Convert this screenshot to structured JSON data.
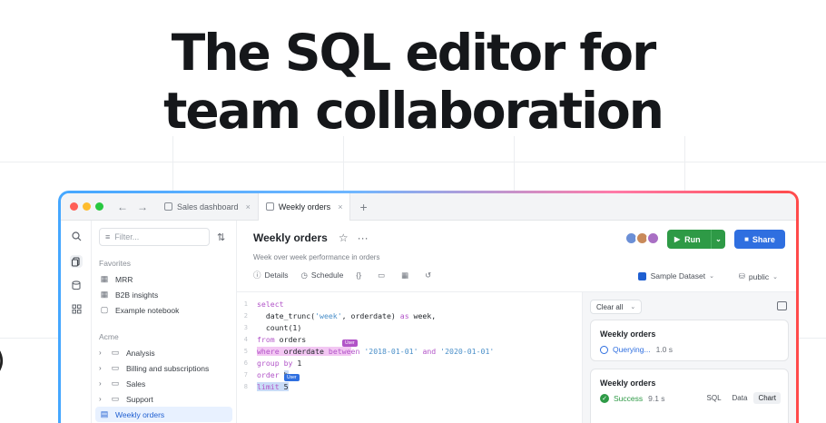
{
  "headline": {
    "line1": "The SQL editor for",
    "line2": "team collaboration"
  },
  "side_glyph": ")",
  "tabs": [
    {
      "label": "Sales dashboard",
      "close": "×"
    },
    {
      "label": "Weekly orders",
      "close": "×"
    }
  ],
  "tab_plus": "+",
  "nav": {
    "back": "←",
    "forward": "→"
  },
  "sidebar": {
    "filter_placeholder": "Filter...",
    "favorites_label": "Favorites",
    "favorites": [
      {
        "label": "MRR",
        "icon": "grid-icon"
      },
      {
        "label": "B2B insights",
        "icon": "grid-icon"
      },
      {
        "label": "Example notebook",
        "icon": "book-icon"
      }
    ],
    "acme_label": "Acme",
    "folders": [
      {
        "label": "Analysis"
      },
      {
        "label": "Billing and subscriptions"
      },
      {
        "label": "Sales"
      },
      {
        "label": "Support"
      }
    ],
    "selected_item": "Weekly orders"
  },
  "main": {
    "title": "Weekly orders",
    "subtitle": "Week over week performance in orders",
    "toolbar": {
      "details": "Details",
      "schedule": "Schedule"
    },
    "run_label": "Run",
    "share_label": "Share",
    "dataset_label": "Sample Dataset",
    "schema_label": "public"
  },
  "editor": {
    "line_numbers": [
      "1",
      "2",
      "3",
      "4",
      "5",
      "6",
      "7",
      "8"
    ],
    "cursor_tags": [
      "User",
      "User"
    ]
  },
  "results": {
    "clear_all_label": "Clear all",
    "cards": [
      {
        "title": "Weekly orders",
        "status": "Querying...",
        "time": "1.0 s"
      },
      {
        "title": "Weekly orders",
        "status": "Success",
        "time": "9.1 s"
      }
    ],
    "view_tabs": [
      "SQL",
      "Data",
      "Chart"
    ]
  },
  "colors": {
    "run": "#2e9a46",
    "share": "#2f6fe0",
    "keyword": "#b254c8",
    "string": "#4a8fc9"
  }
}
